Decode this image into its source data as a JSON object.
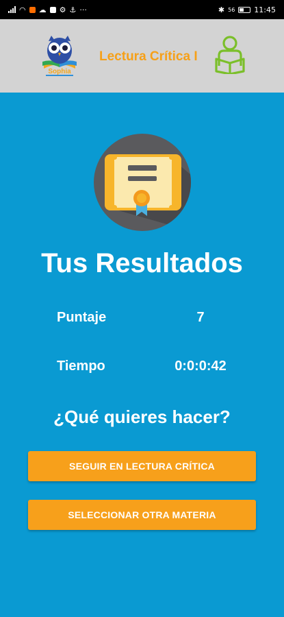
{
  "status_bar": {
    "time": "11:45",
    "battery": "56",
    "more": "···"
  },
  "app_bar": {
    "logo_text": "Sophia",
    "title": "Lectura Crítica I",
    "logo_icon": "owl-logo-icon",
    "right_icon": "person-reading-icon"
  },
  "badge_icon": "certificate-icon",
  "results": {
    "title": "Tus Resultados",
    "rows": [
      {
        "label": "Puntaje",
        "value": "7"
      },
      {
        "label": "Tiempo",
        "value": "0:0:0:42"
      }
    ]
  },
  "question": "¿Qué quieres hacer?",
  "buttons": {
    "continue_label": "SEGUIR EN LECTURA CRÍTICA",
    "other_label": "SELECCIONAR OTRA MATERIA"
  },
  "colors": {
    "background": "#0a9ad2",
    "app_bar": "#d3d3d3",
    "accent": "#f7a01b",
    "title": "#f6a018",
    "reader_icon": "#7bbf2a",
    "badge_bg": "#5a5a5d"
  }
}
